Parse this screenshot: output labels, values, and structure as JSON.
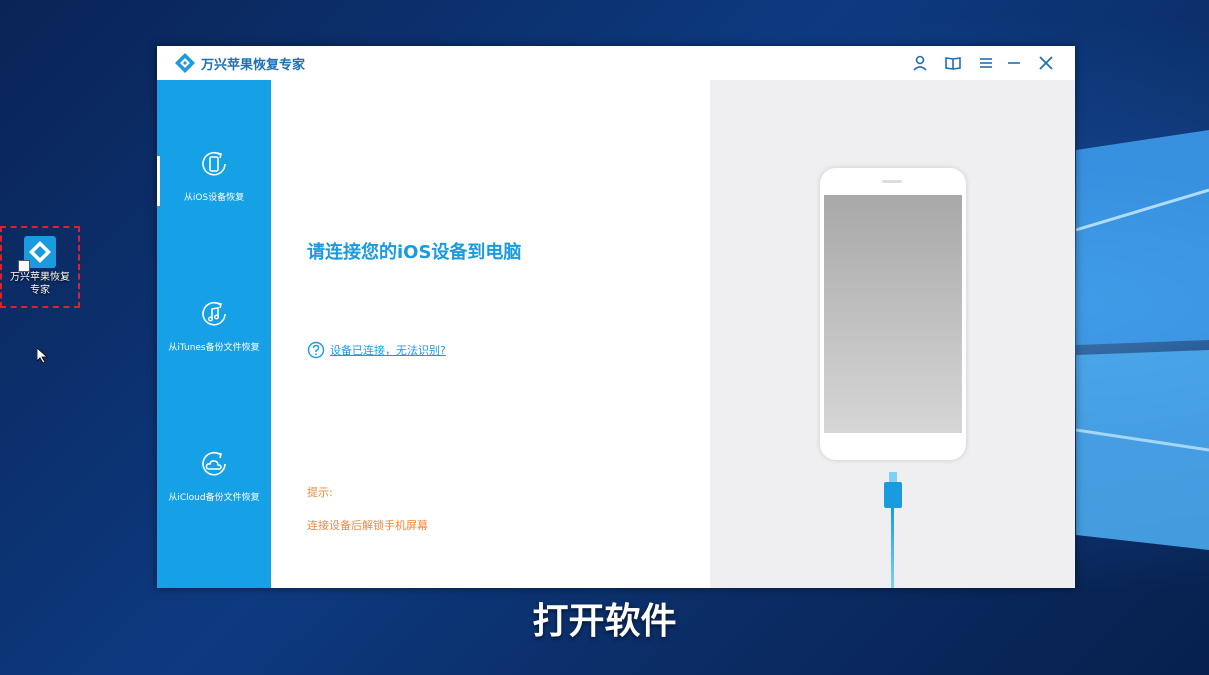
{
  "desktop": {
    "shortcut_label": "万兴苹果恢复专家"
  },
  "app": {
    "title": "万兴苹果恢复专家",
    "title_icons": [
      "user-icon",
      "book-icon",
      "menu-icon",
      "minimize-icon",
      "close-icon"
    ],
    "sidebar": {
      "items": [
        {
          "label": "从iOS设备恢复",
          "icon": "phone-restore-icon",
          "active": true
        },
        {
          "label": "从iTunes备份文件恢复",
          "icon": "music-note-icon",
          "active": false
        },
        {
          "label": "从iCloud备份文件恢复",
          "icon": "cloud-icon",
          "active": false
        }
      ]
    },
    "main": {
      "heading": "请连接您的iOS设备到电脑",
      "help_link": "设备已连接，无法识别?",
      "tip_title": "提示:",
      "tip_text": "连接设备后解锁手机屏幕"
    },
    "colors": {
      "accent": "#16a0e6",
      "tip": "#f0883e"
    }
  },
  "subtitle": "打开软件"
}
